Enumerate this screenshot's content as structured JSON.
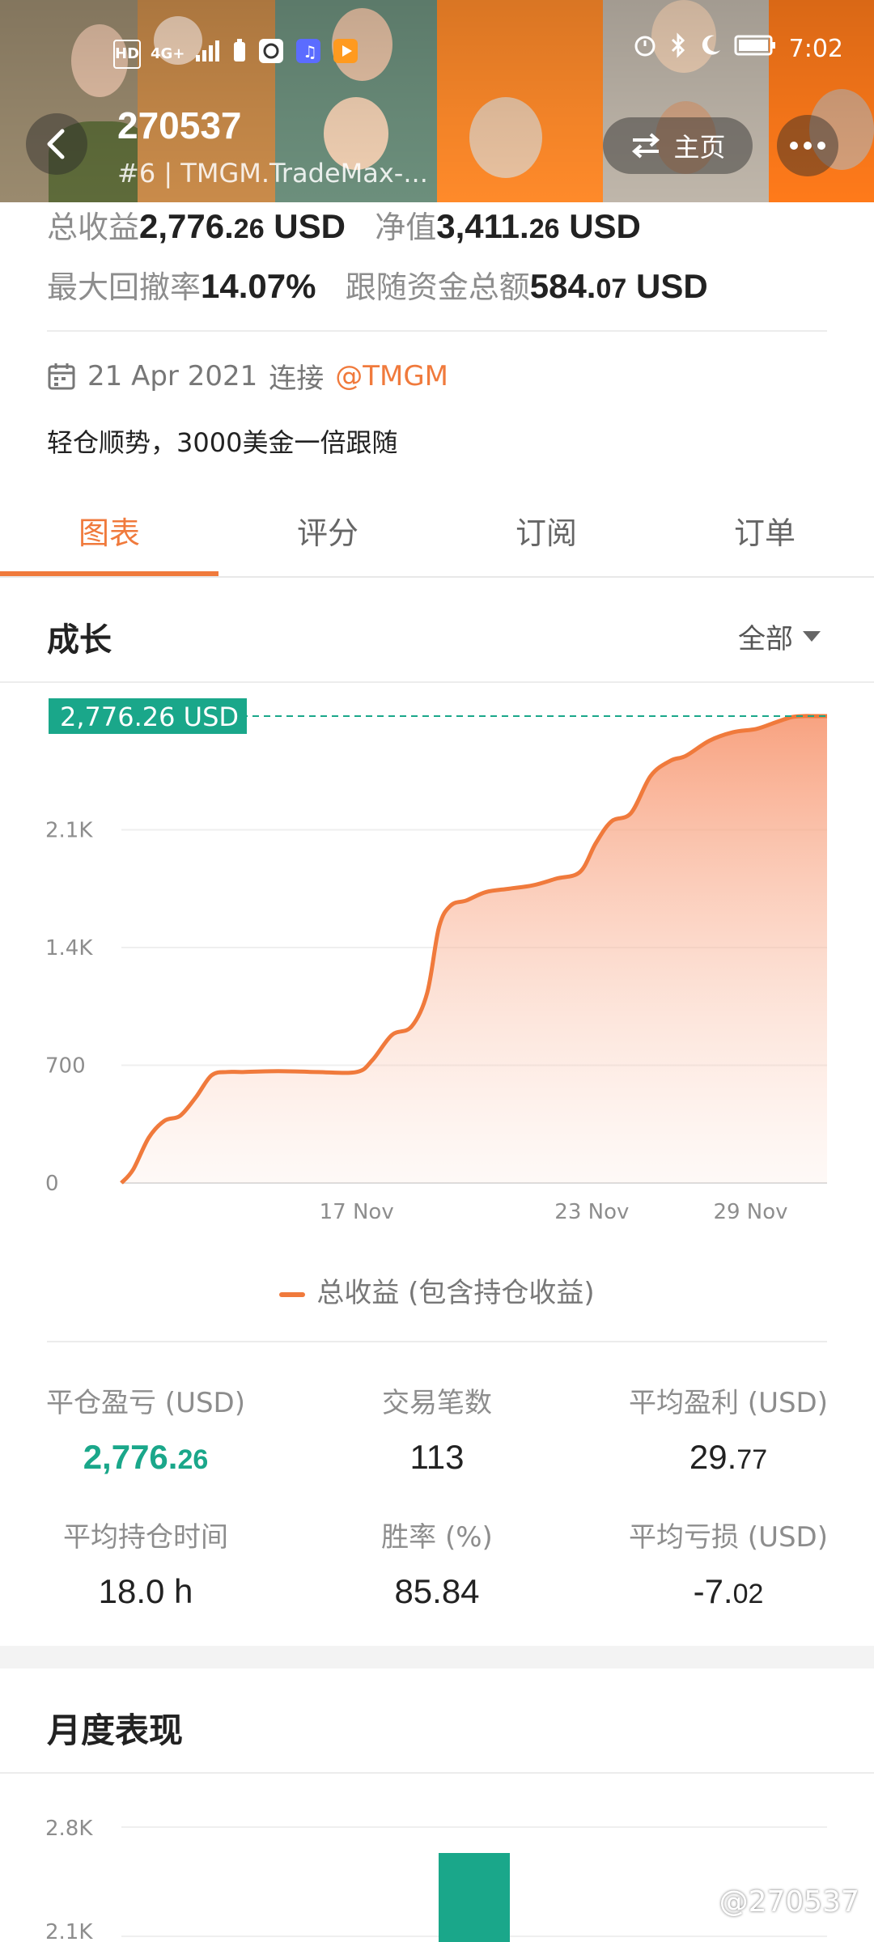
{
  "status_bar": {
    "left_indicators": [
      "HD",
      "4G+"
    ],
    "time": "7:02",
    "icons": [
      "signal-icon",
      "battery-saver-icon",
      "sync-icon",
      "music-icon",
      "video-icon",
      "alarm-icon",
      "bluetooth-icon",
      "moon-icon",
      "battery-icon"
    ]
  },
  "header": {
    "title": "270537",
    "subtitle": "#6 | TMGM.TradeMax-...",
    "home_label": "主页"
  },
  "summary": {
    "total_profit_label": "总收益",
    "total_profit_main": "2,776.",
    "total_profit_small": "26",
    "total_profit_unit": " USD",
    "equity_label": "净值",
    "equity_main": "3,411.",
    "equity_small": "26",
    "equity_unit": " USD",
    "max_drawdown_label": "最大回撤率",
    "max_drawdown_value": "14.07%",
    "follow_funds_label": "跟随资金总额",
    "follow_funds_main": "584.",
    "follow_funds_small": "07",
    "follow_funds_unit": " USD"
  },
  "connection": {
    "date": "21 Apr 2021",
    "connect_label": "连接",
    "broker_tag": "@TMGM"
  },
  "description": "轻仓顺势，3000美金一倍跟随",
  "tabs": [
    {
      "label": "图表"
    },
    {
      "label": "评分"
    },
    {
      "label": "订阅"
    },
    {
      "label": "订单"
    }
  ],
  "growth": {
    "title": "成长",
    "range_label": "全部"
  },
  "chart_data": {
    "type": "area",
    "current_value_label": "2,776.26 USD",
    "y_ticks": [
      "0",
      "700",
      "1.4K",
      "2.1K"
    ],
    "y_tick_values": [
      0,
      700,
      1400,
      2100
    ],
    "ylim": [
      0,
      2800
    ],
    "x_ticks": [
      "17 Nov",
      "23 Nov",
      "29 Nov"
    ],
    "x_tick_positions": [
      6,
      12,
      17
    ],
    "xlim": [
      0,
      18
    ],
    "series": [
      {
        "name": "总收益 (包含持仓收益)",
        "x": [
          0,
          0.3,
          0.7,
          1.1,
          1.5,
          1.9,
          2.3,
          2.7,
          3.1,
          4,
          5,
          6,
          6.4,
          6.9,
          7.4,
          7.8,
          8.1,
          8.4,
          8.8,
          9.3,
          9.9,
          10.5,
          11.1,
          11.7,
          12.1,
          12.5,
          13,
          13.5,
          14,
          14.4,
          15,
          15.6,
          16.2,
          16.7,
          17.1,
          17.4,
          17.6,
          18
        ],
        "y": [
          0,
          80,
          270,
          370,
          400,
          510,
          640,
          660,
          660,
          665,
          660,
          660,
          730,
          880,
          930,
          1130,
          1520,
          1650,
          1680,
          1730,
          1750,
          1770,
          1810,
          1850,
          2020,
          2150,
          2200,
          2420,
          2510,
          2540,
          2630,
          2680,
          2700,
          2740,
          2770,
          2776,
          2776,
          2776
        ]
      }
    ],
    "legend": "总收益 (包含持仓收益)",
    "color": "#f07a3c"
  },
  "stats": [
    {
      "label": "平仓盈亏 (USD)",
      "main": "2,776.",
      "small": "26",
      "highlight": true
    },
    {
      "label": "交易笔数",
      "main": "113",
      "small": ""
    },
    {
      "label": "平均盈利 (USD)",
      "main": "29.",
      "small": "77"
    },
    {
      "label": "平均持仓时间",
      "main": "18.0 h",
      "small": ""
    },
    {
      "label": "胜率 (%)",
      "main": "85.84",
      "small": ""
    },
    {
      "label": "平均亏损 (USD)",
      "main": "-7.",
      "small": "02"
    }
  ],
  "monthly": {
    "title": "月度表现",
    "y_ticks": [
      "2.8K",
      "2.1K"
    ],
    "bar_color": "#1aa78a"
  },
  "watermark": "@270537",
  "colors": {
    "accent": "#f07a3c",
    "green": "#1aa78a",
    "header_bg": "#ff7a1a"
  }
}
